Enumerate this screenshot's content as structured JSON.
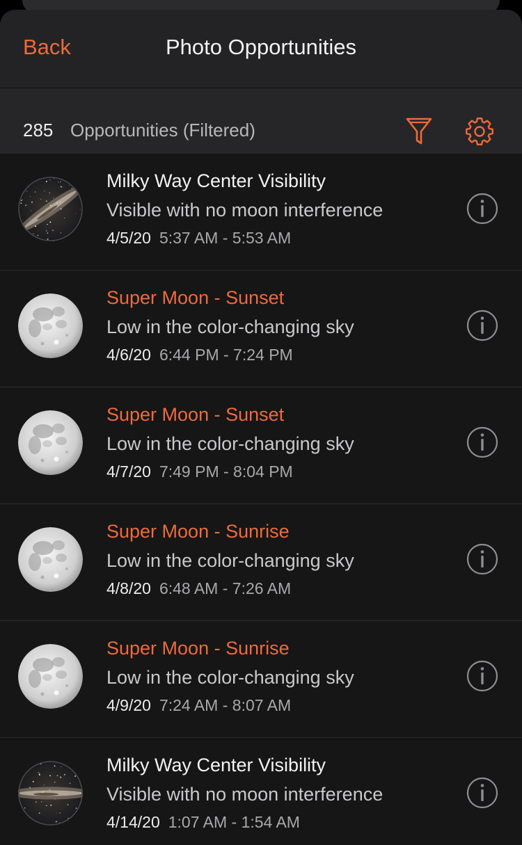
{
  "nav": {
    "back_label": "Back",
    "title": "Photo Opportunities"
  },
  "summary": {
    "count": "285",
    "label": "Opportunities (Filtered)",
    "filter_icon": "funnel-icon",
    "settings_icon": "gear-icon"
  },
  "colors": {
    "accent": "#ee6a3b",
    "background": "#161617",
    "navbar": "#232325",
    "subbar": "#262628"
  },
  "items": [
    {
      "title": "Milky Way Center Visibility",
      "subtitle": "Visible with no moon interference",
      "date": "4/5/20",
      "time": "5:37 AM - 5:53 AM",
      "thumb": "milky-way",
      "highlight": false
    },
    {
      "title": "Super Moon - Sunset",
      "subtitle": "Low in the color-changing sky",
      "date": "4/6/20",
      "time": "6:44 PM - 7:24 PM",
      "thumb": "full-moon",
      "highlight": true
    },
    {
      "title": "Super Moon - Sunset",
      "subtitle": "Low in the color-changing sky",
      "date": "4/7/20",
      "time": "7:49 PM - 8:04 PM",
      "thumb": "full-moon",
      "highlight": true
    },
    {
      "title": "Super Moon - Sunrise",
      "subtitle": "Low in the color-changing sky",
      "date": "4/8/20",
      "time": "6:48 AM - 7:26 AM",
      "thumb": "full-moon",
      "highlight": true
    },
    {
      "title": "Super Moon - Sunrise",
      "subtitle": "Low in the color-changing sky",
      "date": "4/9/20",
      "time": "7:24 AM - 8:07 AM",
      "thumb": "full-moon",
      "highlight": true
    },
    {
      "title": "Milky Way Center Visibility",
      "subtitle": "Visible with no moon interference",
      "date": "4/14/20",
      "time": "1:07 AM - 1:54 AM",
      "thumb": "milky-way",
      "highlight": false
    }
  ]
}
